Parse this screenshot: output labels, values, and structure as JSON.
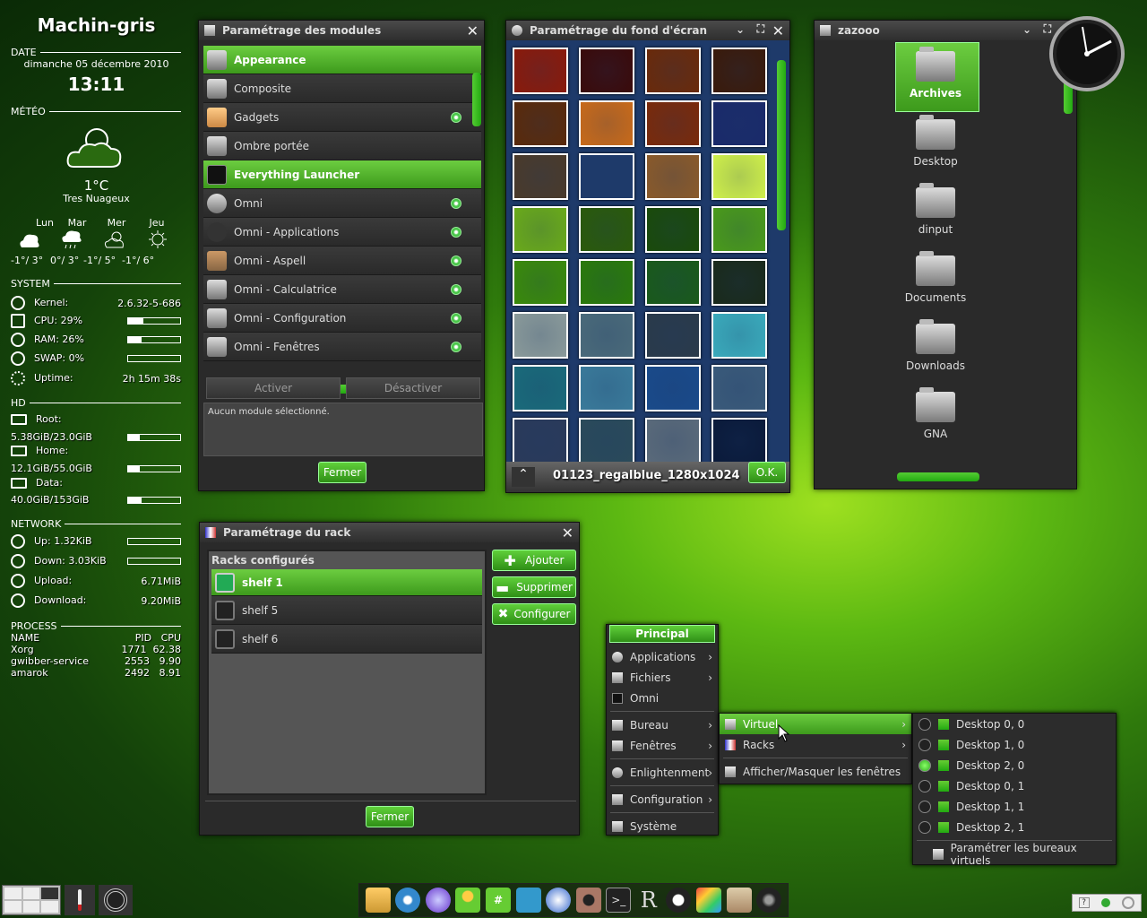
{
  "conky": {
    "hostname": "Machin-gris",
    "date_label": "DATE",
    "date": "dimanche 05 décembre 2010",
    "time": "13:11",
    "weather_label": "MÉTÉO",
    "temp": "1°C",
    "cond": "Tres Nuageux",
    "forecast": [
      {
        "day": "Lun",
        "range": "-1°/ 3°"
      },
      {
        "day": "Mar",
        "range": "0°/ 3°"
      },
      {
        "day": "Mer",
        "range": "-1°/ 5°"
      },
      {
        "day": "Jeu",
        "range": "-1°/ 6°"
      }
    ],
    "system_label": "SYSTEM",
    "kernel_label": "Kernel:",
    "kernel": "2.6.32-5-686",
    "cpu": "CPU: 29%",
    "cpu_pct": 29,
    "ram": "RAM: 26%",
    "ram_pct": 26,
    "swap": "SWAP: 0%",
    "swap_pct": 0,
    "uptime_label": "Uptime:",
    "uptime": "2h 15m 38s",
    "hd_label": "HD",
    "root_label": "Root:",
    "root": "5.38GiB/23.0GiB",
    "root_pct": 23,
    "home_label": "Home:",
    "home": "12.1GiB/55.0GiB",
    "home_pct": 22,
    "data_label": "Data:",
    "data": "40.0GiB/153GiB",
    "data_pct": 26,
    "network_label": "NETWORK",
    "up": "Up: 1.32KiB",
    "down": "Down: 3.03KiB",
    "upload_label": "Upload:",
    "upload": "6.71MiB",
    "download_label": "Download:",
    "download": "9.20MiB",
    "process_label": "PROCESS",
    "proc_h": {
      "name": "NAME",
      "pid": "PID",
      "cpu": "CPU"
    },
    "procs": [
      {
        "name": "Xorg",
        "pid": "1771",
        "cpu": "62.38"
      },
      {
        "name": "gwibber-service",
        "pid": "2553",
        "cpu": "9.90"
      },
      {
        "name": "amarok",
        "pid": "2492",
        "cpu": "8.91"
      }
    ]
  },
  "modules": {
    "title": "Paramétrage des modules",
    "items": [
      "Appearance",
      "Composite",
      "Gadgets",
      "Ombre portée",
      "Everything Launcher",
      "Omni",
      "Omni - Applications",
      "Omni - Aspell",
      "Omni - Calculatrice",
      "Omni - Configuration",
      "Omni - Fenêtres"
    ],
    "activate": "Activer",
    "deactivate": "Désactiver",
    "status": "Aucun module sélectionné.",
    "close": "Fermer"
  },
  "wallpaper": {
    "title": "Paramétrage du fond d'écran",
    "filename": "01123_regalblue_1280x1024",
    "ok": "O.K."
  },
  "files": {
    "title": "zazooo",
    "folders": [
      "Archives",
      "Desktop",
      "dinput",
      "Documents",
      "Downloads",
      "GNA"
    ]
  },
  "rack": {
    "title": "Paramétrage du rack",
    "header": "Racks configurés",
    "items": [
      "shelf 1",
      "shelf 5",
      "shelf 6"
    ],
    "add": "Ajouter",
    "remove": "Supprimer",
    "configure": "Configurer",
    "close": "Fermer"
  },
  "menu": {
    "title": "Principal",
    "items": [
      "Applications",
      "Fichiers",
      "Omni",
      "Bureau",
      "Fenêtres",
      "Enlightenment",
      "Configuration",
      "Système"
    ],
    "sub": [
      "Virtuel",
      "Racks",
      "Afficher/Masquer les fenêtres"
    ],
    "desks": [
      "Desktop 0, 0",
      "Desktop 1, 0",
      "Desktop 2, 0",
      "Desktop 0, 1",
      "Desktop 1, 1",
      "Desktop 2, 1"
    ],
    "desk_settings": "Paramétrer les bureaux virtuels"
  },
  "colors": {
    "accent": "#4cb52a"
  }
}
